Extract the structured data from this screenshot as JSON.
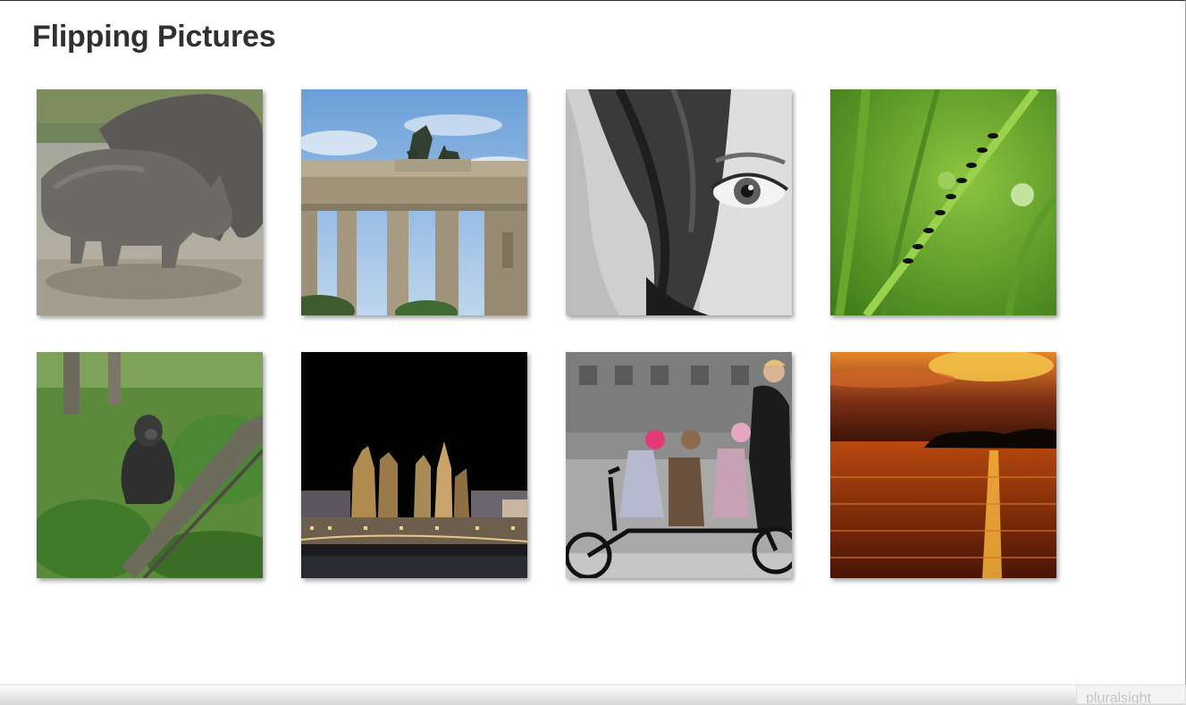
{
  "page": {
    "title": "Flipping Pictures"
  },
  "gallery": {
    "items": [
      {
        "subject": "rhinos",
        "icon": "rhino-photo"
      },
      {
        "subject": "brandenburg-gate",
        "icon": "gate-photo"
      },
      {
        "subject": "eye-portrait",
        "icon": "eye-photo"
      },
      {
        "subject": "ants-on-grass",
        "icon": "ants-photo"
      },
      {
        "subject": "gorilla",
        "icon": "gorilla-photo"
      },
      {
        "subject": "city-lights-night",
        "icon": "city-photo"
      },
      {
        "subject": "tandem-bicycle",
        "icon": "bicycle-photo"
      },
      {
        "subject": "sunset-over-water",
        "icon": "sunset-photo"
      }
    ]
  },
  "watermark": {
    "text": "pluralsight"
  },
  "colors": {
    "title": "#303030",
    "background": "#ffffff"
  }
}
